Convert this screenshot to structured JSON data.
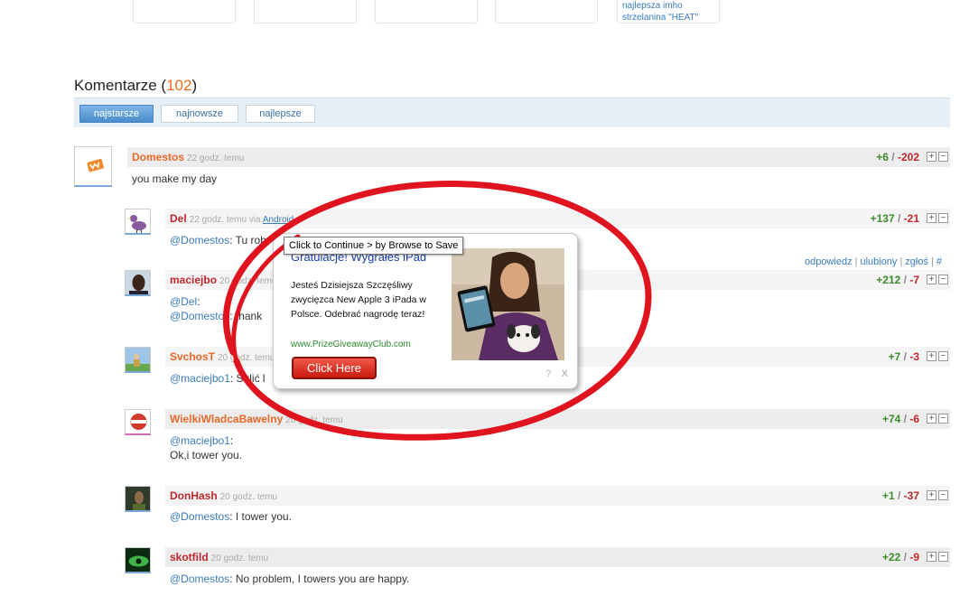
{
  "top_cards": [
    {
      "text": ""
    },
    {
      "text": ""
    },
    {
      "text": ""
    },
    {
      "text": ""
    },
    {
      "text": "najlepsza imho\nstrzelanina \"HEAT\""
    }
  ],
  "comments_section": {
    "title": "Komentarze",
    "count": "102",
    "sort": {
      "oldest": "najstarsze",
      "newest": "najnowsze",
      "best": "najlepsze",
      "active": "najstarsze"
    }
  },
  "comments": [
    {
      "author": "Domestos",
      "time": "22 godz. temu",
      "plus": "+6",
      "minus": "-202",
      "body": "you make my day",
      "avatar": "wykop-logo-icon"
    },
    {
      "author": "Del",
      "time": "22 godz. temu via",
      "via": "Android",
      "plus": "+137",
      "minus": "-21",
      "mention": "@Domestos",
      "body_tail": ": Tu rob",
      "avatar": "bird-icon"
    },
    {
      "author": "maciejbo",
      "time": "20 godz. temu",
      "plus": "+212",
      "minus": "-7",
      "mention": "@Del",
      "body_tail": ":",
      "mention2": "@Domestos",
      "body_tail2": ": thank",
      "avatar": "face-photo-icon"
    },
    {
      "author": "SvchosT",
      "time": "20 godz. temu",
      "plus": "+7",
      "minus": "-3",
      "mention": "@maciejbo1",
      "body_tail": ": Sulić l",
      "avatar": "sports-photo-icon"
    },
    {
      "author": "WielkiWladcaBawelny",
      "time": "20 godz. temu",
      "plus": "+74",
      "minus": "-6",
      "mention": "@maciejbo1",
      "body_tail": ":",
      "body_line2": "Ok,i tower you.",
      "avatar": "brand-logo-icon"
    },
    {
      "author": "DonHash",
      "time": "20 godz. temu",
      "plus": "+1",
      "minus": "-37",
      "mention": "@Domestos",
      "body_tail": ": I tower you.",
      "avatar": "person-photo-icon"
    },
    {
      "author": "skotfild",
      "time": "20 godz. temu",
      "plus": "+22",
      "minus": "-9",
      "mention": "@Domestos",
      "body_tail": ": No problem, I towers you are happy.",
      "avatar": "green-eye-icon"
    }
  ],
  "vote_buttons": {
    "plus": "+",
    "minus": "−",
    "separator": "/"
  },
  "comment_actions": {
    "reply": "odpowiedz",
    "favorite": "ulubiony",
    "report": "zgłoś",
    "permalink": "#"
  },
  "popup": {
    "tooltip": "Click to Continue > by Browse to Save",
    "title": "Gratulacje! Wygrałeś iPad",
    "body": "Jesteś Dzisiejsza Szczęśliwy zwycięzca New Apple 3 iPada w Polsce. Odebrać nagrodę teraz!",
    "url": "www.PrizeGiveawayClub.com",
    "button": "Click Here",
    "help": "?",
    "close": "X"
  },
  "colors": {
    "annotation_ellipse": "#e0141e",
    "link_blue": "#3a7bbf",
    "orange_count": "#f26b1d",
    "vote_plus": "#3d8c2b",
    "vote_minus": "#c0272d"
  }
}
